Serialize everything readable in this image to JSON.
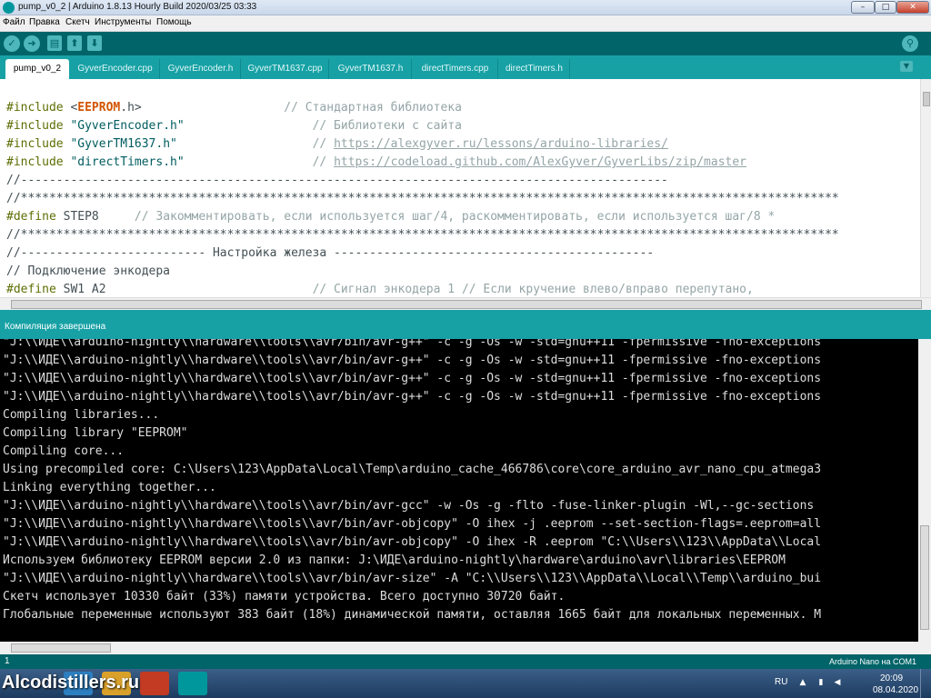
{
  "window": {
    "title": "pump_v0_2 | Arduino 1.8.13 Hourly Build 2020/03/25 03:33",
    "minimize": "–",
    "maximize": "□",
    "close": "✕"
  },
  "menu": [
    "Файл",
    "Правка",
    "Скетч",
    "Инструменты",
    "Помощь"
  ],
  "toolbar": {
    "verify": "✓",
    "upload": "➜",
    "new": "▤",
    "open": "⬆",
    "save": "⬇",
    "serial_monitor": "⚲"
  },
  "tabs": [
    "pump_v0_2",
    "GyverEncoder.cpp",
    "GyverEncoder.h",
    "GyverTM1637.cpp",
    "GyverTM1637.h",
    "directTimers.cpp",
    "directTimers.h"
  ],
  "tab_menu": "▼",
  "editor": {
    "inc": "#include",
    "define": "#define",
    "l1_lib": "EEPROM",
    "l1_open": " <",
    "l1_close": ".h>",
    "l1_pad": "                    ",
    "l1_cmt": "// Стандартная библиотека",
    "l2_str": " \"GyverEncoder.h\"",
    "l2_pad": "                  ",
    "l2_cmt": "// Библиотеки с сайта",
    "l3_str": " \"GyverTM1637.h\"",
    "l3_pad": "                   ",
    "l3_cmt": "// ",
    "l3_url": "https://alexgyver.ru/lessons/arduino-libraries/",
    "l4_str": " \"directTimers.h\"",
    "l4_pad": "                  ",
    "l4_cmt": "// ",
    "l4_url": "https://codeload.github.com/AlexGyver/GyverLibs/zip/master",
    "l5": "//-------------------------------------------------------------------------------------------",
    "l6": "//*******************************************************************************************************************",
    "l7_name": " STEP8",
    "l7_cmt": "     // Закомментировать, если используется шаг/4, раскомментировать, если используется шаг/8 *",
    "l8": "//*******************************************************************************************************************",
    "l9": "//-------------------------- Настройка железа ---------------------------------------------",
    "l10": "// Подключение энкодера",
    "l11_name": " SW1 A2",
    "l11_pad": "                             ",
    "l11_cmt": "// Сигнал энкодера 1 // Если кручение влево/вправо перепутано,"
  },
  "status": "Компиляция завершена",
  "console": [
    "\"J:\\\\ИДЕ\\\\arduino-nightly\\\\hardware\\\\tools\\\\avr/bin/avr-g++\" -c -g -Os -w -std=gnu++11 -fpermissive -fno-exceptions",
    "\"J:\\\\ИДЕ\\\\arduino-nightly\\\\hardware\\\\tools\\\\avr/bin/avr-g++\" -c -g -Os -w -std=gnu++11 -fpermissive -fno-exceptions",
    "\"J:\\\\ИДЕ\\\\arduino-nightly\\\\hardware\\\\tools\\\\avr/bin/avr-g++\" -c -g -Os -w -std=gnu++11 -fpermissive -fno-exceptions",
    "\"J:\\\\ИДЕ\\\\arduino-nightly\\\\hardware\\\\tools\\\\avr/bin/avr-g++\" -c -g -Os -w -std=gnu++11 -fpermissive -fno-exceptions",
    "Compiling libraries...",
    "Compiling library \"EEPROM\"",
    "Compiling core...",
    "Using precompiled core: C:\\Users\\123\\AppData\\Local\\Temp\\arduino_cache_466786\\core\\core_arduino_avr_nano_cpu_atmega3",
    "Linking everything together...",
    "\"J:\\\\ИДЕ\\\\arduino-nightly\\\\hardware\\\\tools\\\\avr/bin/avr-gcc\" -w -Os -g -flto -fuse-linker-plugin -Wl,--gc-sections",
    "\"J:\\\\ИДЕ\\\\arduino-nightly\\\\hardware\\\\tools\\\\avr/bin/avr-objcopy\" -O ihex -j .eeprom --set-section-flags=.eeprom=all",
    "\"J:\\\\ИДЕ\\\\arduino-nightly\\\\hardware\\\\tools\\\\avr/bin/avr-objcopy\" -O ihex -R .eeprom \"C:\\\\Users\\\\123\\\\AppData\\\\Local",
    "Используем библиотеку EEPROM версии 2.0 из папки: J:\\ИДЕ\\arduino-nightly\\hardware\\arduino\\avr\\libraries\\EEPROM",
    "\"J:\\\\ИДЕ\\\\arduino-nightly\\\\hardware\\\\tools\\\\avr/bin/avr-size\" -A \"C:\\\\Users\\\\123\\\\AppData\\\\Local\\\\Temp\\\\arduino_bui",
    "Скетч использует 10330 байт (33%) памяти устройства. Всего доступно 30720 байт.",
    "Глобальные переменные используют 383 байт (18%) динамической памяти, оставляя 1665 байт для локальных переменных. М"
  ],
  "footer": {
    "line_number": "1",
    "board": "Arduino Nano на COM1"
  },
  "taskbar": {
    "watermark": "Alcodistillers.ru",
    "language": "RU",
    "time": "20:09",
    "date": "08.04.2020",
    "tray_flag": "▲",
    "tray_network": "▮",
    "tray_volume": "◀"
  },
  "colors": {
    "toolbar_bg": "#006468",
    "tab_bg": "#17a1a5",
    "console_bg": "#000000",
    "keyword": "#5e6d03",
    "library": "#d35400",
    "string": "#005c5f",
    "comment": "#95a5a6"
  }
}
